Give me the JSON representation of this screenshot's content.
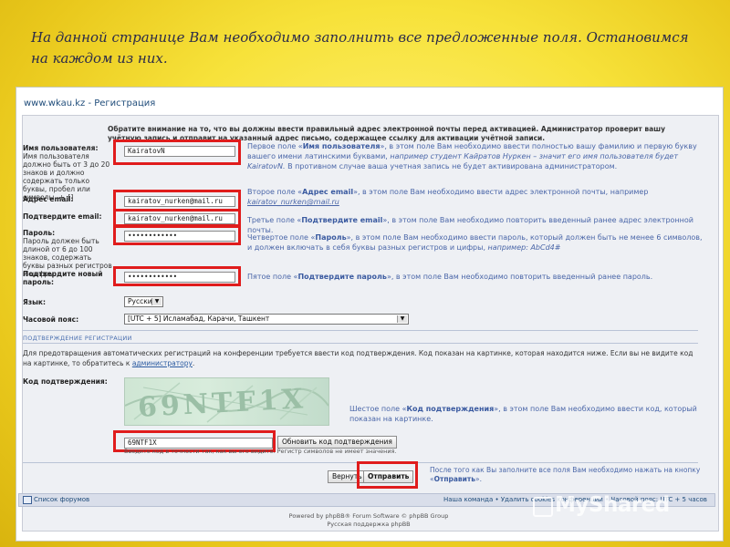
{
  "slide": {
    "title": "На данной странице Вам необходимо заполнить все предложенные поля. Остановимся на каждом из них."
  },
  "window": {
    "title": "www.wkau.kz - Регистрация"
  },
  "form": {
    "notice": "Обратите внимание на то, что вы должны ввести правильный адрес электронной почты перед активацией. Администратор проверит вашу учётную запись и отправит на указанный адрес письмо, содержащее ссылку для активации учётной записи.",
    "username": {
      "label": "Имя пользователя:",
      "sub": "Имя пользователя должно быть от 3 до 20 знаков и должно содержать только буквы, пробел или символы -+_[]",
      "value": "KairatovN",
      "explain_prefix": "Первое поле «",
      "explain_bold": "Имя пользователя",
      "explain_mid": "», в этом поле Вам необходимо ввести полностью вашу фамилию и первую букву вашего имени латинскими буквами, ",
      "explain_italic": "например студент Кайратов Нуркен – значит его имя пользователя будет KairatovN.",
      "explain_end": " В противном случае ваша учетная запись не будет активирована администратором."
    },
    "email": {
      "label": "Адрес email:",
      "value": "kairatov_nurken@mail.ru",
      "explain_prefix": "Второе поле «",
      "explain_bold": "Адрес email",
      "explain_mid": "», в этом поле Вам необходимо ввести адрес электронной почты, например ",
      "explain_example": "kairatov_nurken@mail.ru"
    },
    "email_confirm": {
      "label": "Подтвердите email:",
      "value": "kairatov_nurken@mail.ru",
      "explain_prefix": "Третье поле «",
      "explain_bold": "Подтвердите email",
      "explain_end": "», в этом поле Вам необходимо повторить введенный ранее адрес электронной почты."
    },
    "password": {
      "label": "Пароль:",
      "sub": "Пароль должен быть длиной от 6 до 100 знаков, содержать буквы разных регистров и цифры.",
      "value": "••••••••••••",
      "explain_prefix": "Четвертое поле «",
      "explain_bold": "Пароль",
      "explain_mid": "», в этом поле Вам необходимо ввести пароль, который должен быть не менее 6 символов, и должен включать в себя буквы разных регистров и цифры, ",
      "explain_italic": "например: AbCd4#"
    },
    "password_confirm": {
      "label": "Подтвердите новый пароль:",
      "value": "••••••••••••",
      "explain_prefix": "Пятое поле «",
      "explain_bold": "Подтвердите пароль",
      "explain_end": "», в этом поле Вам необходимо повторить введенный ранее пароль."
    },
    "language": {
      "label": "Язык:",
      "value": "Русский"
    },
    "timezone": {
      "label": "Часовой пояс:",
      "value": "[UTC + 5] Исламабад, Карачи, Ташкент"
    }
  },
  "confirmation": {
    "section_title": "ПОДТВЕРЖДЕНИЕ РЕГИСТРАЦИИ",
    "text_prefix": "Для предотвращения автоматических регистраций на конференции требуется ввести код подтверждения. Код показан на картинке, которая находится ниже. Если вы не видите код на картинке, то обратитесь к ",
    "text_link": "администратору",
    "text_end": ".",
    "code_label": "Код подтверждения:",
    "code_value": "69NTF1X",
    "refresh_button": "Обновить код подтверждения",
    "hint": "Введите код в точности так, как вы его видите. Регистр символов не имеет значения.",
    "explain_prefix": "Шестое поле «",
    "explain_bold": "Код подтверждения",
    "explain_end": "», в этом поле Вам необходимо ввести код, который показан на картинке."
  },
  "actions": {
    "back": "Вернуть",
    "submit": "Отправить",
    "explain_prefix": "После того как Вы заполните все поля Вам необходимо нажать на кнопку «",
    "explain_bold": "Отправить",
    "explain_end": "»."
  },
  "footer": {
    "forum_index": "Список форумов",
    "right_links": "Наша команда • Удалить cookies конференции • Часовой пояс: UTC + 5 часов",
    "powered": "Powered by phpBB® Forum Software © phpBB Group",
    "support": "Русская поддержка phpBB"
  },
  "watermark": "MyShared"
}
